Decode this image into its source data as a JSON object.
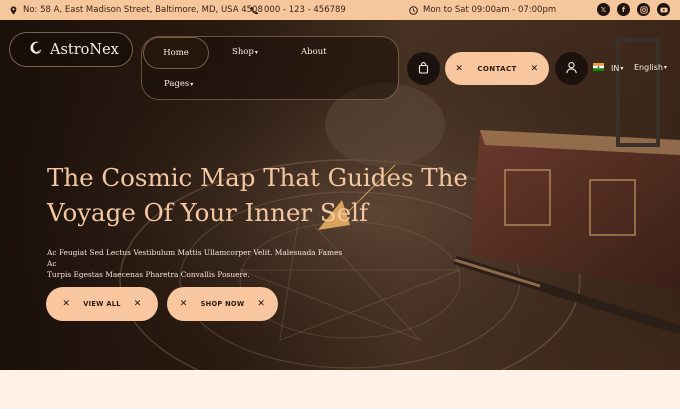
{
  "topbar": {
    "address": "No: 58 A, East Madison Street, Baltimore, MD, USA 4508",
    "phone": "000 - 123 - 456789",
    "hours": "Mon to Sat 09:00am - 07:00pm",
    "socials": [
      "x-icon",
      "facebook-icon",
      "instagram-icon",
      "youtube-icon"
    ]
  },
  "brand": {
    "name": "AstroNex"
  },
  "nav": {
    "home": "Home",
    "shop": "Shop",
    "about": "About",
    "pages": "Pages",
    "contact": "CONTACT",
    "lang_code": "IN",
    "language": "English"
  },
  "hero": {
    "title_line1": "The Cosmic Map That Guides The",
    "title_line2": "Voyage Of Your Inner Self",
    "subtitle_line1": "Ac Feugiat Sed Lectus Vestibulum Mattis Ullamcorper Velit. Malesuada Fames Ac",
    "subtitle_line2": "Turpis Egestas Maecenas Pharetra Convallis Posuere.",
    "btn_view_all": "VIEW ALL",
    "btn_shop_now": "SHOP NOW"
  },
  "colors": {
    "accent": "#f8c79f",
    "topbar_bg": "#f6c79d",
    "dark": "#1b120d",
    "title": "#f4c8a2"
  }
}
